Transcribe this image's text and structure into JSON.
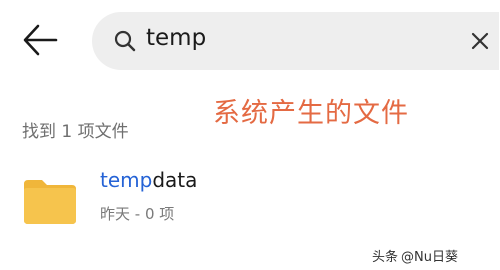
{
  "header": {
    "back_icon": "arrow-left-icon",
    "search": {
      "icon": "search-icon",
      "value": "temp",
      "clear_icon": "close-icon"
    }
  },
  "annotation": "系统产生的文件",
  "results": {
    "count_label": "找到 1 项文件",
    "items": [
      {
        "icon": "folder-icon",
        "name_match": "temp",
        "name_rest": "data",
        "meta": "昨天 - 0 项"
      }
    ]
  },
  "watermark": {
    "logo": "头条",
    "handle": "@Nu日葵"
  },
  "colors": {
    "highlight": "#2563d6",
    "annotation": "#e46a43",
    "folder": "#f6c44d"
  }
}
